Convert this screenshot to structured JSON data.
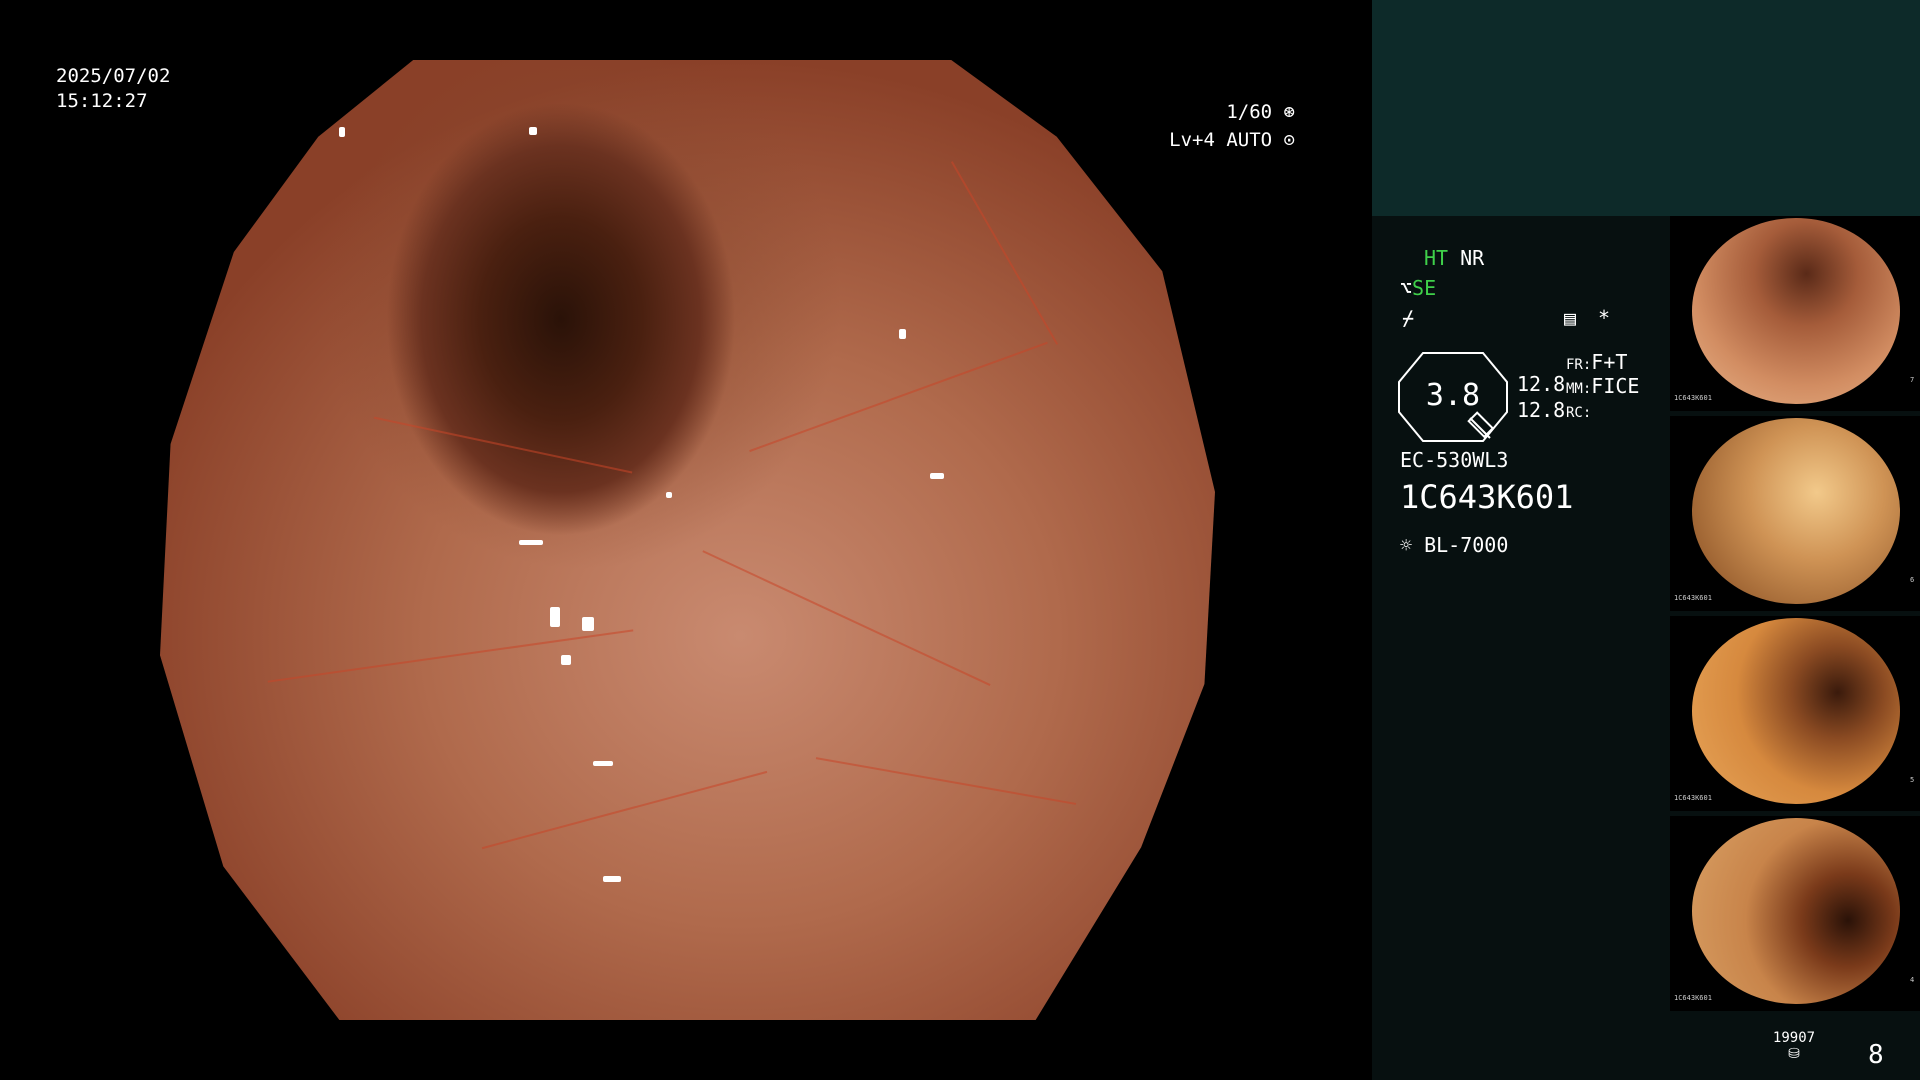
{
  "overlay": {
    "date": "2025/07/02",
    "time": "15:12:27",
    "shutter": "1/60",
    "level": "Lv+4 AUTO"
  },
  "panel": {
    "ht": "HT",
    "nr": "NR",
    "se": "SE",
    "asterisk": "*",
    "zoom": "3.8",
    "zoom_val_1": "12.8",
    "zoom_val_2": "12.8",
    "fr_label": "FR:",
    "fr_value": "F+T",
    "mm_label": "MM:",
    "mm_value": "FICE",
    "rc_label": "RC:",
    "scope_model": "EC-530WL3",
    "scope_serial": "1C643K601",
    "light_source": "BL-7000",
    "storage_count": "19907",
    "image_count": "8"
  },
  "thumbnails": [
    {
      "serial": "1C643K601",
      "index": "7"
    },
    {
      "serial": "1C643K601",
      "index": "6"
    },
    {
      "serial": "1C643K601",
      "index": "5"
    },
    {
      "serial": "1C643K601",
      "index": "4"
    }
  ],
  "colors": {
    "panel_bg": "#071010",
    "panel_header": "#0d2a29",
    "status_green": "#3fd04a"
  }
}
